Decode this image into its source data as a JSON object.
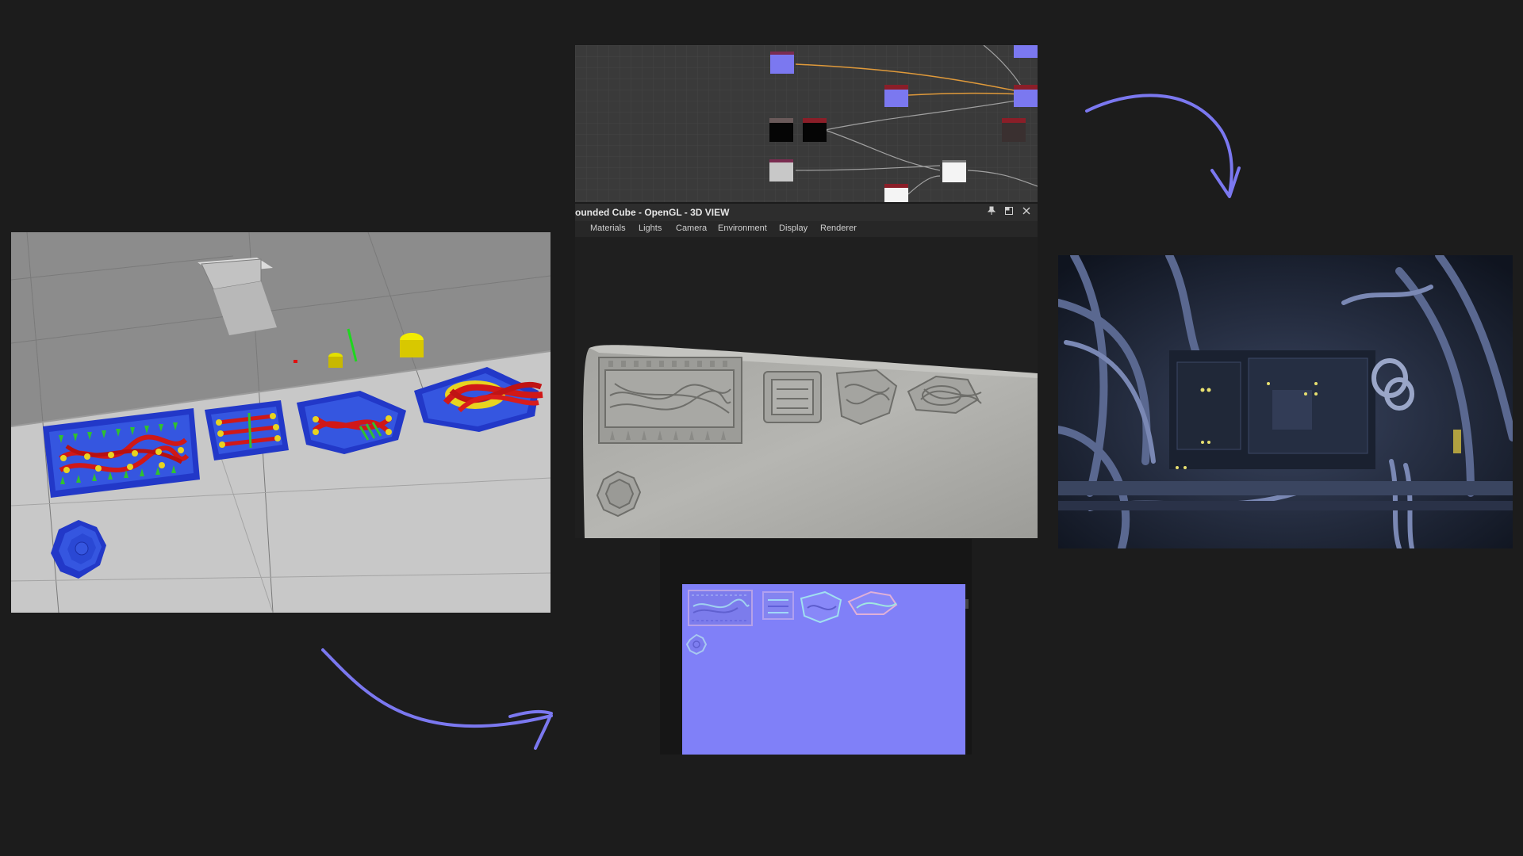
{
  "view3d": {
    "title": "ounded Cube - OpenGL - 3D VIEW",
    "menu": [
      "Materials",
      "Lights",
      "Camera",
      "Environment",
      "Display",
      "Renderer"
    ],
    "buttons": {
      "pin": "pin-icon",
      "maximize": "maximize-icon",
      "close": "close-icon"
    }
  },
  "colors": {
    "background": "#1c1c1c",
    "arrow": "#7b78f0",
    "node_purple": "#7b78f0",
    "node_header_red": "#8a1e28",
    "wire_orange": "#e09a3a",
    "normal_map": "#8080f8",
    "part_blue": "#2a4fd0",
    "cable_red": "#d01818",
    "connector_yellow": "#e8d420",
    "pin_green": "#30c030"
  }
}
